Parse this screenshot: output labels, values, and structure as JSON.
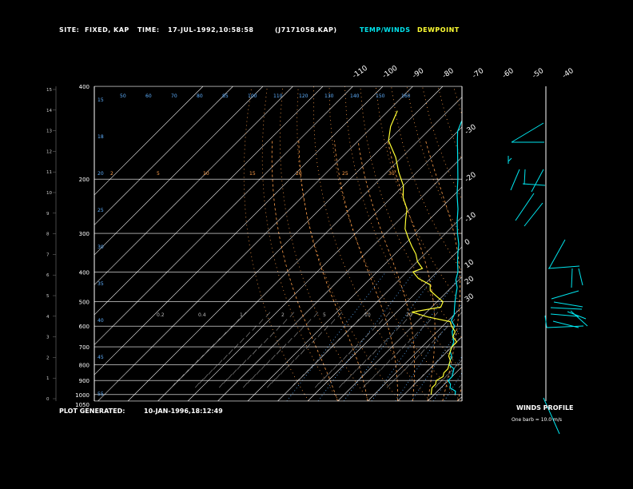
{
  "header": {
    "site_label": "SITE:",
    "site_value": "FIXED, KAP",
    "time_label": "TIME:",
    "time_value": "17-JUL-1992,10:58:58",
    "file": "(J7171058.KAP)",
    "legend_temp": "TEMP/WINDS",
    "legend_dew": "DEWPOINT"
  },
  "footer": {
    "generated_label": "PLOT GENERATED:",
    "generated_value": "10-JAN-1996,18:12:49"
  },
  "winds": {
    "title": "WINDS PROFILE",
    "note": "One barb = 10.0 m/s"
  },
  "colors": {
    "background": "#000000",
    "temp": "#00e5ee",
    "dew": "#ffff33",
    "grid": "#ffffff",
    "dry_adiabat": "#ff9f4a",
    "moist_adiabat": "#ff9f4a",
    "mixing_ratio": "#5fb0ff",
    "height": "#5fb0ff"
  },
  "chart_data": {
    "type": "line",
    "subtype": "skew-T log-p diagram",
    "pressure_levels": [
      "400",
      "200",
      "300",
      "400",
      "500",
      "600",
      "700",
      "800",
      "900",
      "1000",
      "1050"
    ],
    "left_height_ticks": [
      "15",
      "14",
      "13",
      "12",
      "11",
      "10",
      "9",
      "8",
      "7",
      "6",
      "5",
      "4",
      "3",
      "2",
      "1",
      "0"
    ],
    "top_temp_labels": [
      "-110",
      "-100",
      "-90",
      "-80",
      "-70",
      "-60",
      "-50",
      "-40"
    ],
    "right_temp_labels": [
      "-30",
      "-20",
      "-10",
      "0",
      "10",
      "20",
      "30"
    ],
    "row_values_top": [
      "50",
      "60",
      "70",
      "80",
      "85",
      "100",
      "110",
      "120",
      "130",
      "140",
      "150",
      "160"
    ],
    "row_values_mid": [
      "2",
      "5",
      "10",
      "15",
      "20",
      "25",
      "30"
    ],
    "row_values_low": [
      "0.2",
      "0.4",
      "1",
      "2",
      "5",
      "10",
      "20"
    ],
    "left_edge_labels": [
      "15",
      "18",
      "20",
      "25",
      "30",
      "35",
      "40",
      "45",
      "55"
    ],
    "series": [
      {
        "name": "TEMP/WINDS",
        "points": [
          [
            1000,
            27
          ],
          [
            975,
            26
          ],
          [
            950,
            23
          ],
          [
            925,
            22
          ],
          [
            900,
            20
          ],
          [
            875,
            20
          ],
          [
            850,
            19
          ],
          [
            825,
            18
          ],
          [
            800,
            15
          ],
          [
            775,
            14
          ],
          [
            750,
            13
          ],
          [
            725,
            11
          ],
          [
            700,
            10
          ],
          [
            675,
            9
          ],
          [
            650,
            7
          ],
          [
            625,
            5
          ],
          [
            600,
            4
          ],
          [
            575,
            1
          ],
          [
            550,
            0
          ],
          [
            525,
            -2
          ],
          [
            500,
            -4
          ],
          [
            475,
            -6
          ],
          [
            450,
            -8
          ],
          [
            425,
            -11
          ],
          [
            400,
            -13
          ],
          [
            375,
            -16
          ],
          [
            350,
            -19
          ],
          [
            325,
            -22
          ],
          [
            300,
            -26
          ],
          [
            275,
            -30
          ],
          [
            250,
            -34
          ],
          [
            225,
            -39
          ],
          [
            200,
            -44
          ],
          [
            175,
            -50
          ],
          [
            150,
            -57
          ],
          [
            140,
            -60
          ],
          [
            130,
            -62
          ],
          [
            120,
            -62
          ]
        ]
      },
      {
        "name": "DEWPOINT",
        "points": [
          [
            1000,
            19
          ],
          [
            975,
            18
          ],
          [
            950,
            17
          ],
          [
            925,
            17
          ],
          [
            900,
            16
          ],
          [
            875,
            17
          ],
          [
            850,
            16
          ],
          [
            825,
            16
          ],
          [
            800,
            15
          ],
          [
            775,
            14
          ],
          [
            750,
            12
          ],
          [
            725,
            11
          ],
          [
            700,
            10
          ],
          [
            675,
            10
          ],
          [
            650,
            7
          ],
          [
            625,
            6
          ],
          [
            600,
            3
          ],
          [
            580,
            1
          ],
          [
            560,
            -8
          ],
          [
            540,
            -15
          ],
          [
            520,
            -7
          ],
          [
            500,
            -8
          ],
          [
            480,
            -12
          ],
          [
            460,
            -16
          ],
          [
            440,
            -18
          ],
          [
            420,
            -24
          ],
          [
            400,
            -28
          ],
          [
            390,
            -26
          ],
          [
            370,
            -30
          ],
          [
            350,
            -33
          ],
          [
            330,
            -37
          ],
          [
            310,
            -41
          ],
          [
            290,
            -45
          ],
          [
            270,
            -48
          ],
          [
            250,
            -51
          ],
          [
            230,
            -56
          ],
          [
            210,
            -60
          ],
          [
            190,
            -66
          ],
          [
            170,
            -72
          ],
          [
            150,
            -80
          ],
          [
            135,
            -84
          ],
          [
            120,
            -87
          ]
        ]
      }
    ],
    "xlabel": "",
    "ylabel": "",
    "xlim": [
      -40,
      40
    ],
    "ylim": [
      1050,
      100
    ],
    "grid": true,
    "legend": "top"
  }
}
